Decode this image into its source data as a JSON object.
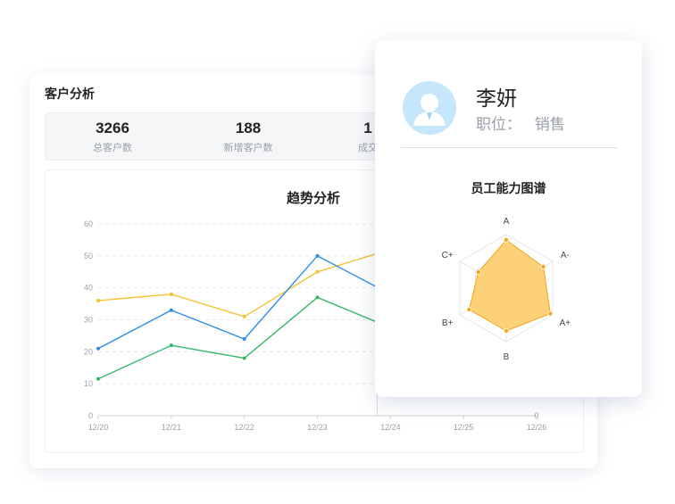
{
  "customer_panel": {
    "title": "客户分析",
    "stats": [
      {
        "value": "3266",
        "label": "总客户数"
      },
      {
        "value": "188",
        "label": "新增客户数"
      },
      {
        "value": "1",
        "label": "成交"
      }
    ]
  },
  "employee_card": {
    "name": "李妍",
    "role_label": "职位：",
    "role_value": "销售",
    "avatar_icon": "user-avatar-icon",
    "radar_title": "员工能力图谱"
  },
  "colors": {
    "yellow": "#f2c230",
    "blue": "#2f8de4",
    "green": "#34b86a",
    "radar_fill": "#fbc960",
    "radar_point": "#f3a51c",
    "avatar_bg": "#c6e6fb"
  },
  "chart_data": [
    {
      "type": "line",
      "title": "趋势分析",
      "xlabel": "",
      "ylabel": "",
      "x": [
        "12/20",
        "12/21",
        "12/22",
        "12/23",
        "12/24",
        "12/25",
        "12/26"
      ],
      "ylim": [
        0,
        60
      ],
      "y_ticks": [
        0,
        10,
        20,
        30,
        40,
        50,
        60
      ],
      "grid": true,
      "series": [
        {
          "color": "#f2c230",
          "values": [
            36,
            38,
            31,
            45,
            52,
            null,
            null
          ]
        },
        {
          "color": "#2f8de4",
          "values": [
            21,
            33,
            24,
            50,
            38,
            null,
            null
          ]
        },
        {
          "color": "#34b86a",
          "values": [
            11.5,
            22,
            18,
            37,
            27.5,
            null,
            null
          ]
        }
      ]
    },
    {
      "type": "radar",
      "title": "员工能力图谱",
      "axes": [
        "A",
        "A-",
        "A+",
        "B",
        "B+",
        "C+"
      ],
      "max": 100,
      "values": [
        90,
        80,
        95,
        80,
        80,
        60
      ]
    }
  ]
}
